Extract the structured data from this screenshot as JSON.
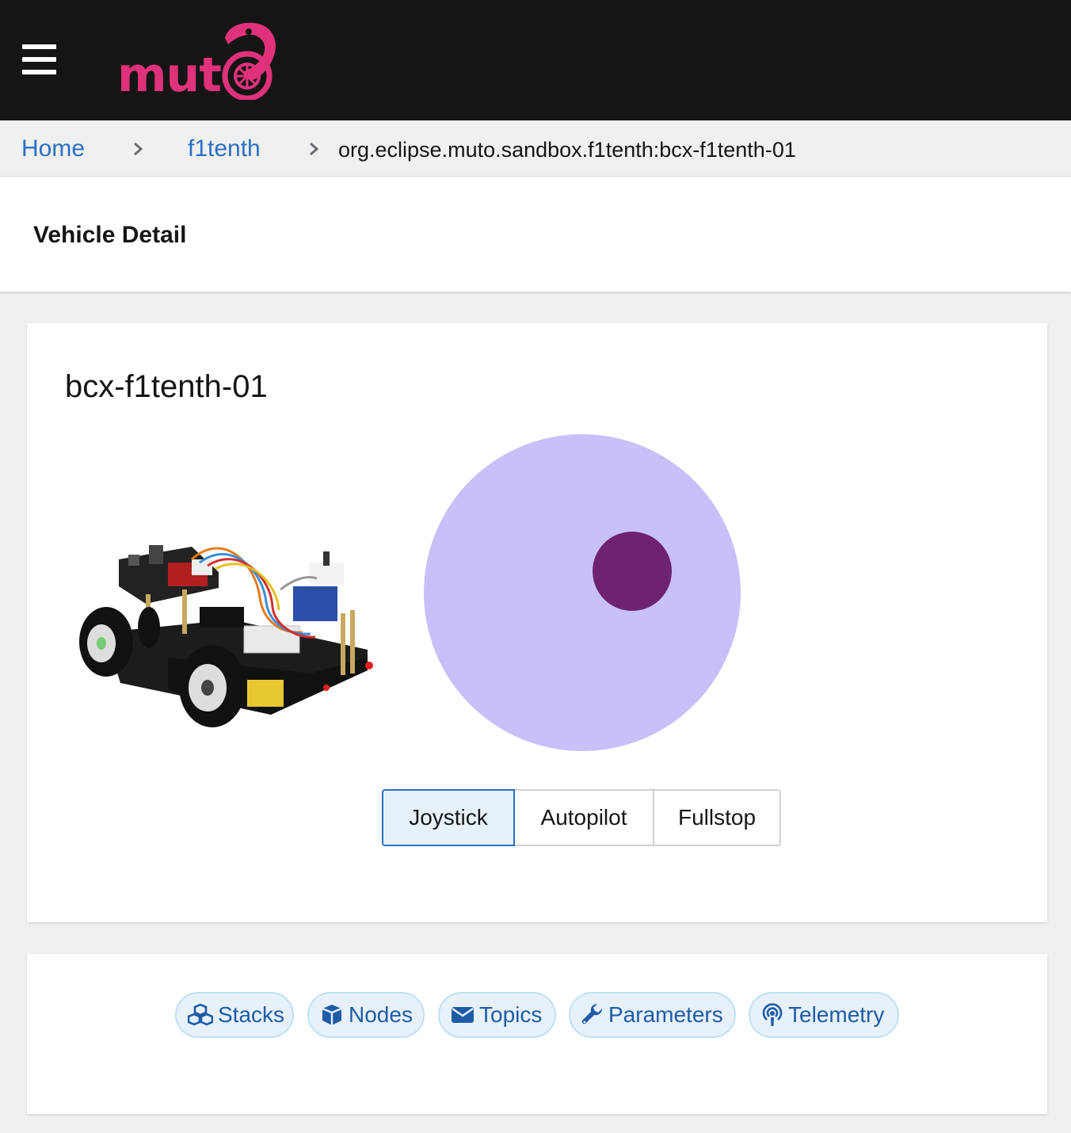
{
  "app": {
    "brand": "muto",
    "brand_color": "#e0327a",
    "masthead_color": "#151515"
  },
  "breadcrumb": {
    "items": [
      {
        "label": "Home"
      },
      {
        "label": "f1tenth"
      },
      {
        "label": "org.eclipse.muto.sandbox.f1tenth:bcx-f1tenth-01"
      }
    ]
  },
  "page": {
    "title": "Vehicle Detail"
  },
  "vehicle": {
    "name": "bcx-f1tenth-01",
    "image_icon": "robot-car-image"
  },
  "joystick": {
    "base_color": "#c8c0f8",
    "knob_color": "#6e2370",
    "knob_offset": {
      "x": 0.315,
      "y": -0.135
    }
  },
  "mode_toggle": {
    "selected": "Joystick",
    "options": [
      "Joystick",
      "Autopilot",
      "Fullstop"
    ]
  },
  "tabs": {
    "items": [
      {
        "label": "Stacks",
        "icon": "cubes-icon"
      },
      {
        "label": "Nodes",
        "icon": "cube-icon"
      },
      {
        "label": "Topics",
        "icon": "envelope-icon"
      },
      {
        "label": "Parameters",
        "icon": "wrench-icon"
      },
      {
        "label": "Telemetry",
        "icon": "podcast-icon"
      }
    ],
    "accent": "#1f5ba6"
  }
}
